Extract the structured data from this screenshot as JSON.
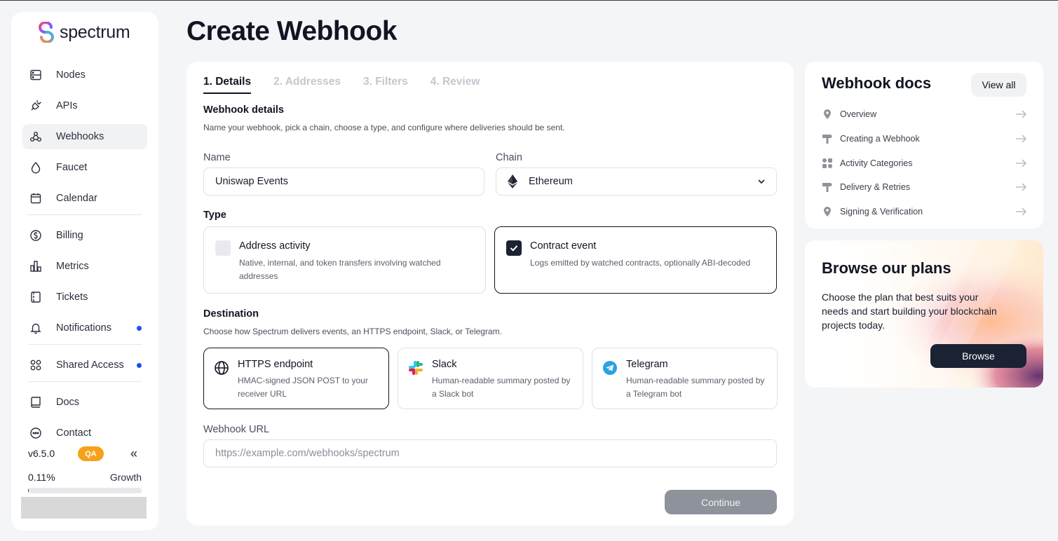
{
  "brand": {
    "name": "spectrum"
  },
  "sidebar": {
    "items": [
      {
        "label": "Nodes",
        "icon": "server-icon"
      },
      {
        "label": "APIs",
        "icon": "plug-icon"
      },
      {
        "label": "Webhooks",
        "icon": "webhook-icon",
        "active": true
      },
      {
        "label": "Faucet",
        "icon": "drop-icon"
      },
      {
        "label": "Calendar",
        "icon": "calendar-icon"
      },
      {
        "label": "Billing",
        "icon": "dollar-icon"
      },
      {
        "label": "Metrics",
        "icon": "bar-chart-icon"
      },
      {
        "label": "Tickets",
        "icon": "ticket-icon"
      },
      {
        "label": "Notifications",
        "icon": "bell-icon",
        "dot": true
      },
      {
        "label": "Shared Access",
        "icon": "grid-circles-icon",
        "dot": true
      },
      {
        "label": "Docs",
        "icon": "book-icon"
      },
      {
        "label": "Contact",
        "icon": "chat-icon"
      }
    ],
    "version": "v6.5.0",
    "env_badge": "QA",
    "collapse": "«",
    "usage": {
      "percent_label": "0.11%",
      "plan": "Growth",
      "fraction": 0.0011
    }
  },
  "page": {
    "title": "Create Webhook"
  },
  "wizard": {
    "tabs": [
      "1. Details",
      "2. Addresses",
      "3. Filters",
      "4. Review"
    ],
    "active_tab": 0,
    "details": {
      "title": "Webhook details",
      "subtitle": "Name your webhook, pick a chain, choose a type, and configure where deliveries should be sent."
    },
    "name": {
      "label": "Name",
      "value": "Uniswap Events"
    },
    "chain": {
      "label": "Chain",
      "value": "Ethereum"
    },
    "type": {
      "title": "Type",
      "options": [
        {
          "title": "Address activity",
          "desc": "Native, internal, and token transfers involving watched addresses",
          "checked": false
        },
        {
          "title": "Contract event",
          "desc": "Logs emitted by watched contracts, optionally ABI-decoded",
          "checked": true
        }
      ]
    },
    "destination": {
      "title": "Destination",
      "subtitle": "Choose how Spectrum delivers events, an HTTPS endpoint, Slack, or Telegram.",
      "options": [
        {
          "title": "HTTPS endpoint",
          "desc": "HMAC-signed JSON POST to your receiver URL",
          "icon": "globe-icon",
          "selected": true
        },
        {
          "title": "Slack",
          "desc": "Human-readable summary posted by a Slack bot",
          "icon": "slack-icon",
          "selected": false
        },
        {
          "title": "Telegram",
          "desc": "Human-readable summary posted by a Telegram bot",
          "icon": "telegram-icon",
          "selected": false
        }
      ]
    },
    "url": {
      "label": "Webhook URL",
      "placeholder": "https://example.com/webhooks/spectrum"
    },
    "continue_label": "Continue"
  },
  "docs": {
    "title": "Webhook docs",
    "view_all": "View all",
    "links": [
      {
        "label": "Overview",
        "icon": "pin-icon"
      },
      {
        "label": "Creating a Webhook",
        "icon": "signpost-icon"
      },
      {
        "label": "Activity Categories",
        "icon": "categories-icon"
      },
      {
        "label": "Delivery & Retries",
        "icon": "signpost-icon"
      },
      {
        "label": "Signing & Verification",
        "icon": "pin-icon"
      }
    ]
  },
  "plans": {
    "title": "Browse our plans",
    "desc": "Choose the plan that best suits your needs and start building your blockchain projects today.",
    "button": "Browse"
  },
  "colors": {
    "accent": "#1a2233",
    "notification_dot": "#1f4ff0",
    "qa_badge": "#f5a21a"
  }
}
